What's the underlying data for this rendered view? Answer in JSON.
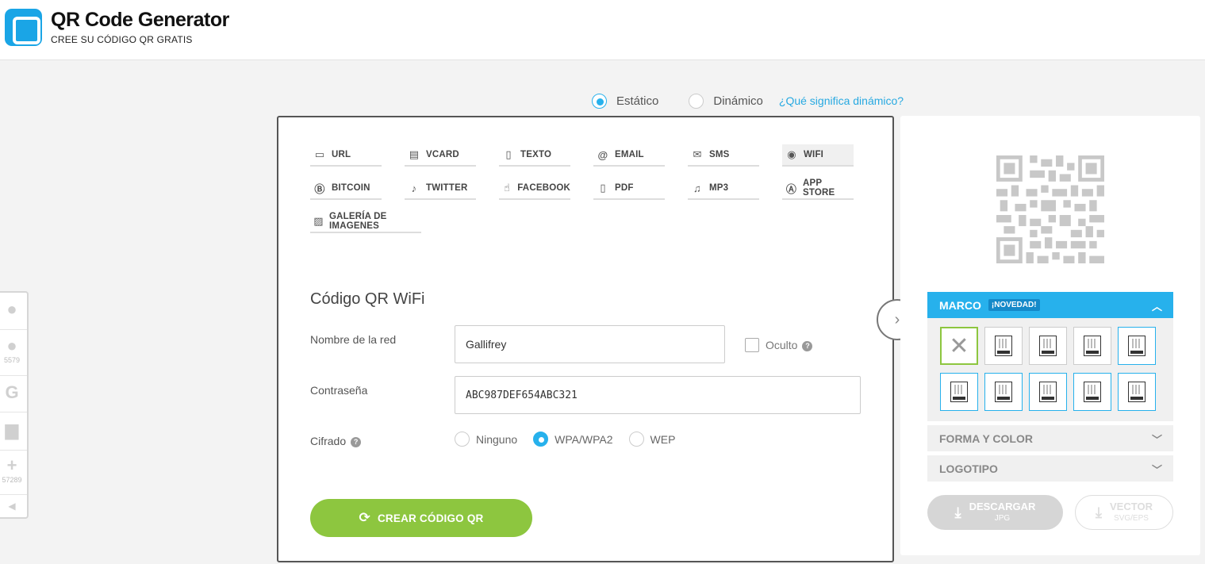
{
  "header": {
    "title": "QR Code Generator",
    "subtitle": "CREE SU CÓDIGO QR GRATIS"
  },
  "mode": {
    "static_label": "Estático",
    "dynamic_label": "Dinámico",
    "help_link": "¿Qué significa dinámico?",
    "selected": "static"
  },
  "tabs": [
    {
      "label": "URL",
      "icon": "url-icon"
    },
    {
      "label": "VCARD",
      "icon": "vcard-icon"
    },
    {
      "label": "TEXTO",
      "icon": "document-icon"
    },
    {
      "label": "EMAIL",
      "icon": "at-icon"
    },
    {
      "label": "SMS",
      "icon": "sms-icon"
    },
    {
      "label": "WIFI",
      "icon": "wifi-icon",
      "active": true
    },
    {
      "label": "BITCOIN",
      "icon": "bitcoin-icon"
    },
    {
      "label": "TWITTER",
      "icon": "twitter-icon"
    },
    {
      "label": "FACEBOOK",
      "icon": "thumbs-up-icon"
    },
    {
      "label": "PDF",
      "icon": "pdf-icon"
    },
    {
      "label": "MP3",
      "icon": "music-icon"
    },
    {
      "label": "APP STORE",
      "icon": "app-store-icon"
    },
    {
      "label": "GALERÍA DE IMAGENES",
      "icon": "image-icon"
    }
  ],
  "form": {
    "title": "Código QR WiFi",
    "network_label": "Nombre de la red",
    "network_value": "Gallifrey",
    "hidden_label": "Oculto",
    "password_label": "Contraseña",
    "password_value": "ABC987DEF654ABC321",
    "encryption_label": "Cifrado",
    "encryption_options": [
      "Ninguno",
      "WPA/WPA2",
      "WEP"
    ],
    "encryption_selected": "WPA/WPA2",
    "create_button": "CREAR CÓDIGO QR"
  },
  "right_panel": {
    "marco_label": "MARCO",
    "marco_badge": "¡NOVEDAD!",
    "shape_color_label": "FORMA Y COLOR",
    "logo_label": "LOGOTIPO",
    "download_label": "DESCARGAR",
    "download_sub": "JPG",
    "vector_label": "VECTOR",
    "vector_sub": "SVG/EPS"
  },
  "social": {
    "facebook_count": "5579",
    "share_count": "57289"
  },
  "colors": {
    "accent_blue": "#27b1ec",
    "green": "#8dc63f"
  }
}
